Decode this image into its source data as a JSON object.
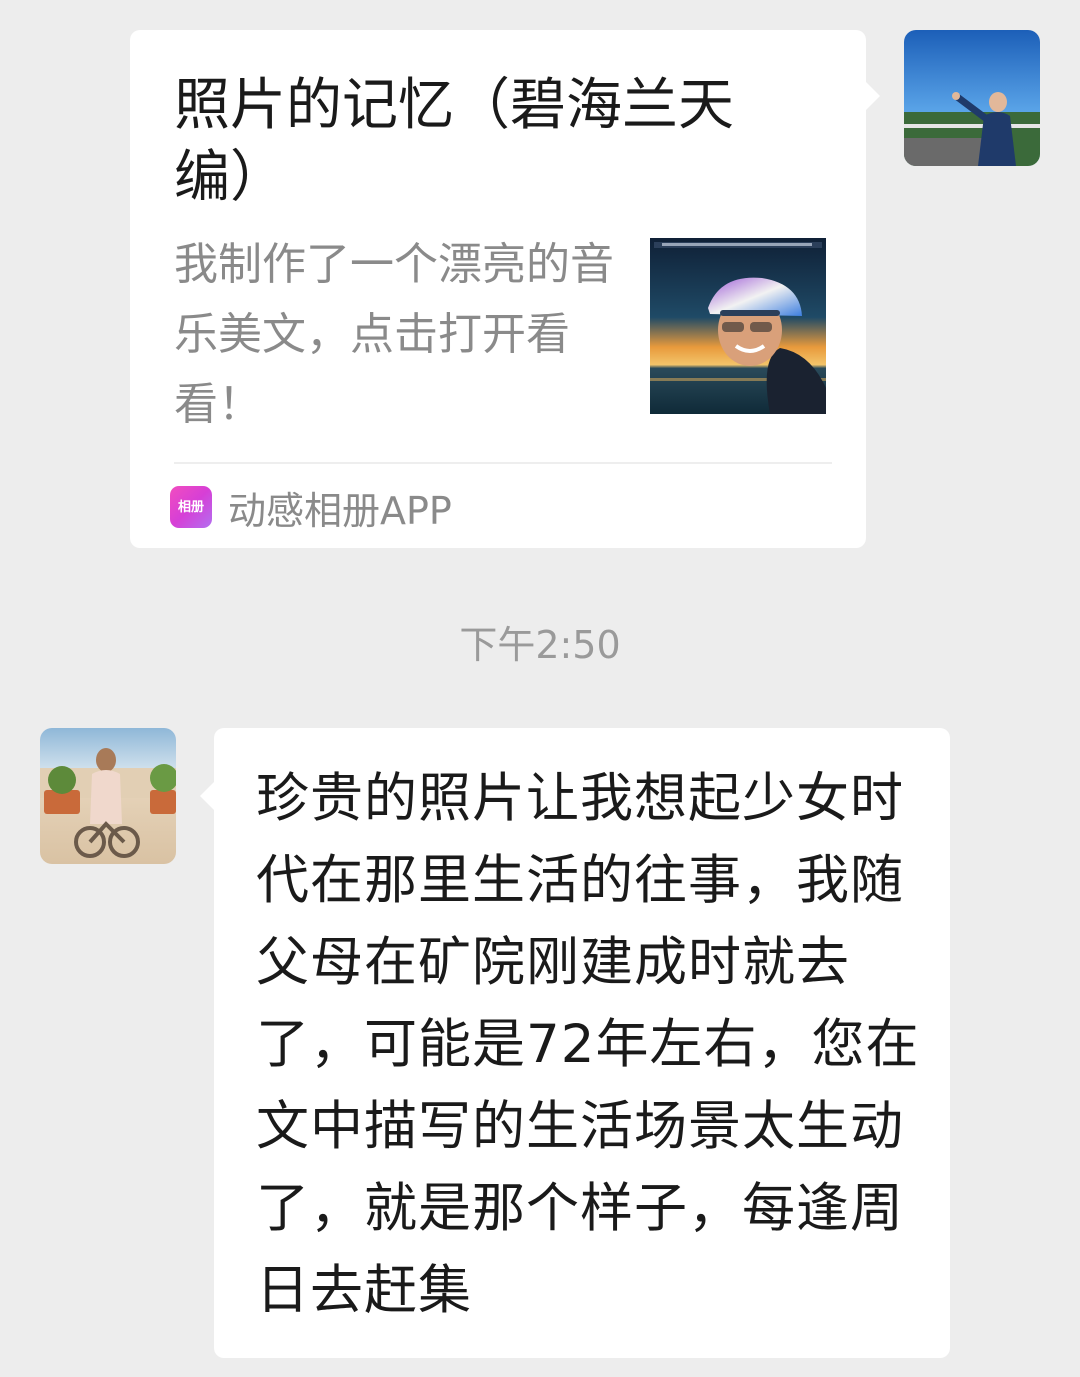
{
  "chat": {
    "link_card": {
      "title": "照片的记忆（碧海兰天编）",
      "description": "我制作了一个漂亮的音乐美文，点击打开看看！",
      "source_app": "动感相册APP",
      "app_icon_text": "相册",
      "app_icon_colors": [
        "#f24dbf",
        "#b36ff0"
      ]
    },
    "timestamp": "下午2:50",
    "received_message": {
      "text": "珍贵的照片让我想起少女时代在那里生活的往事，我随父母在矿院刚建成时就去了，可能是72年左右，您在文中描写的生活场景太生动了，就是那个样子，每逢周日去赶集"
    }
  },
  "colors": {
    "background": "#ededed",
    "bubble": "#ffffff",
    "text_primary": "#1a1a1a",
    "text_secondary": "#8a8a8a"
  }
}
